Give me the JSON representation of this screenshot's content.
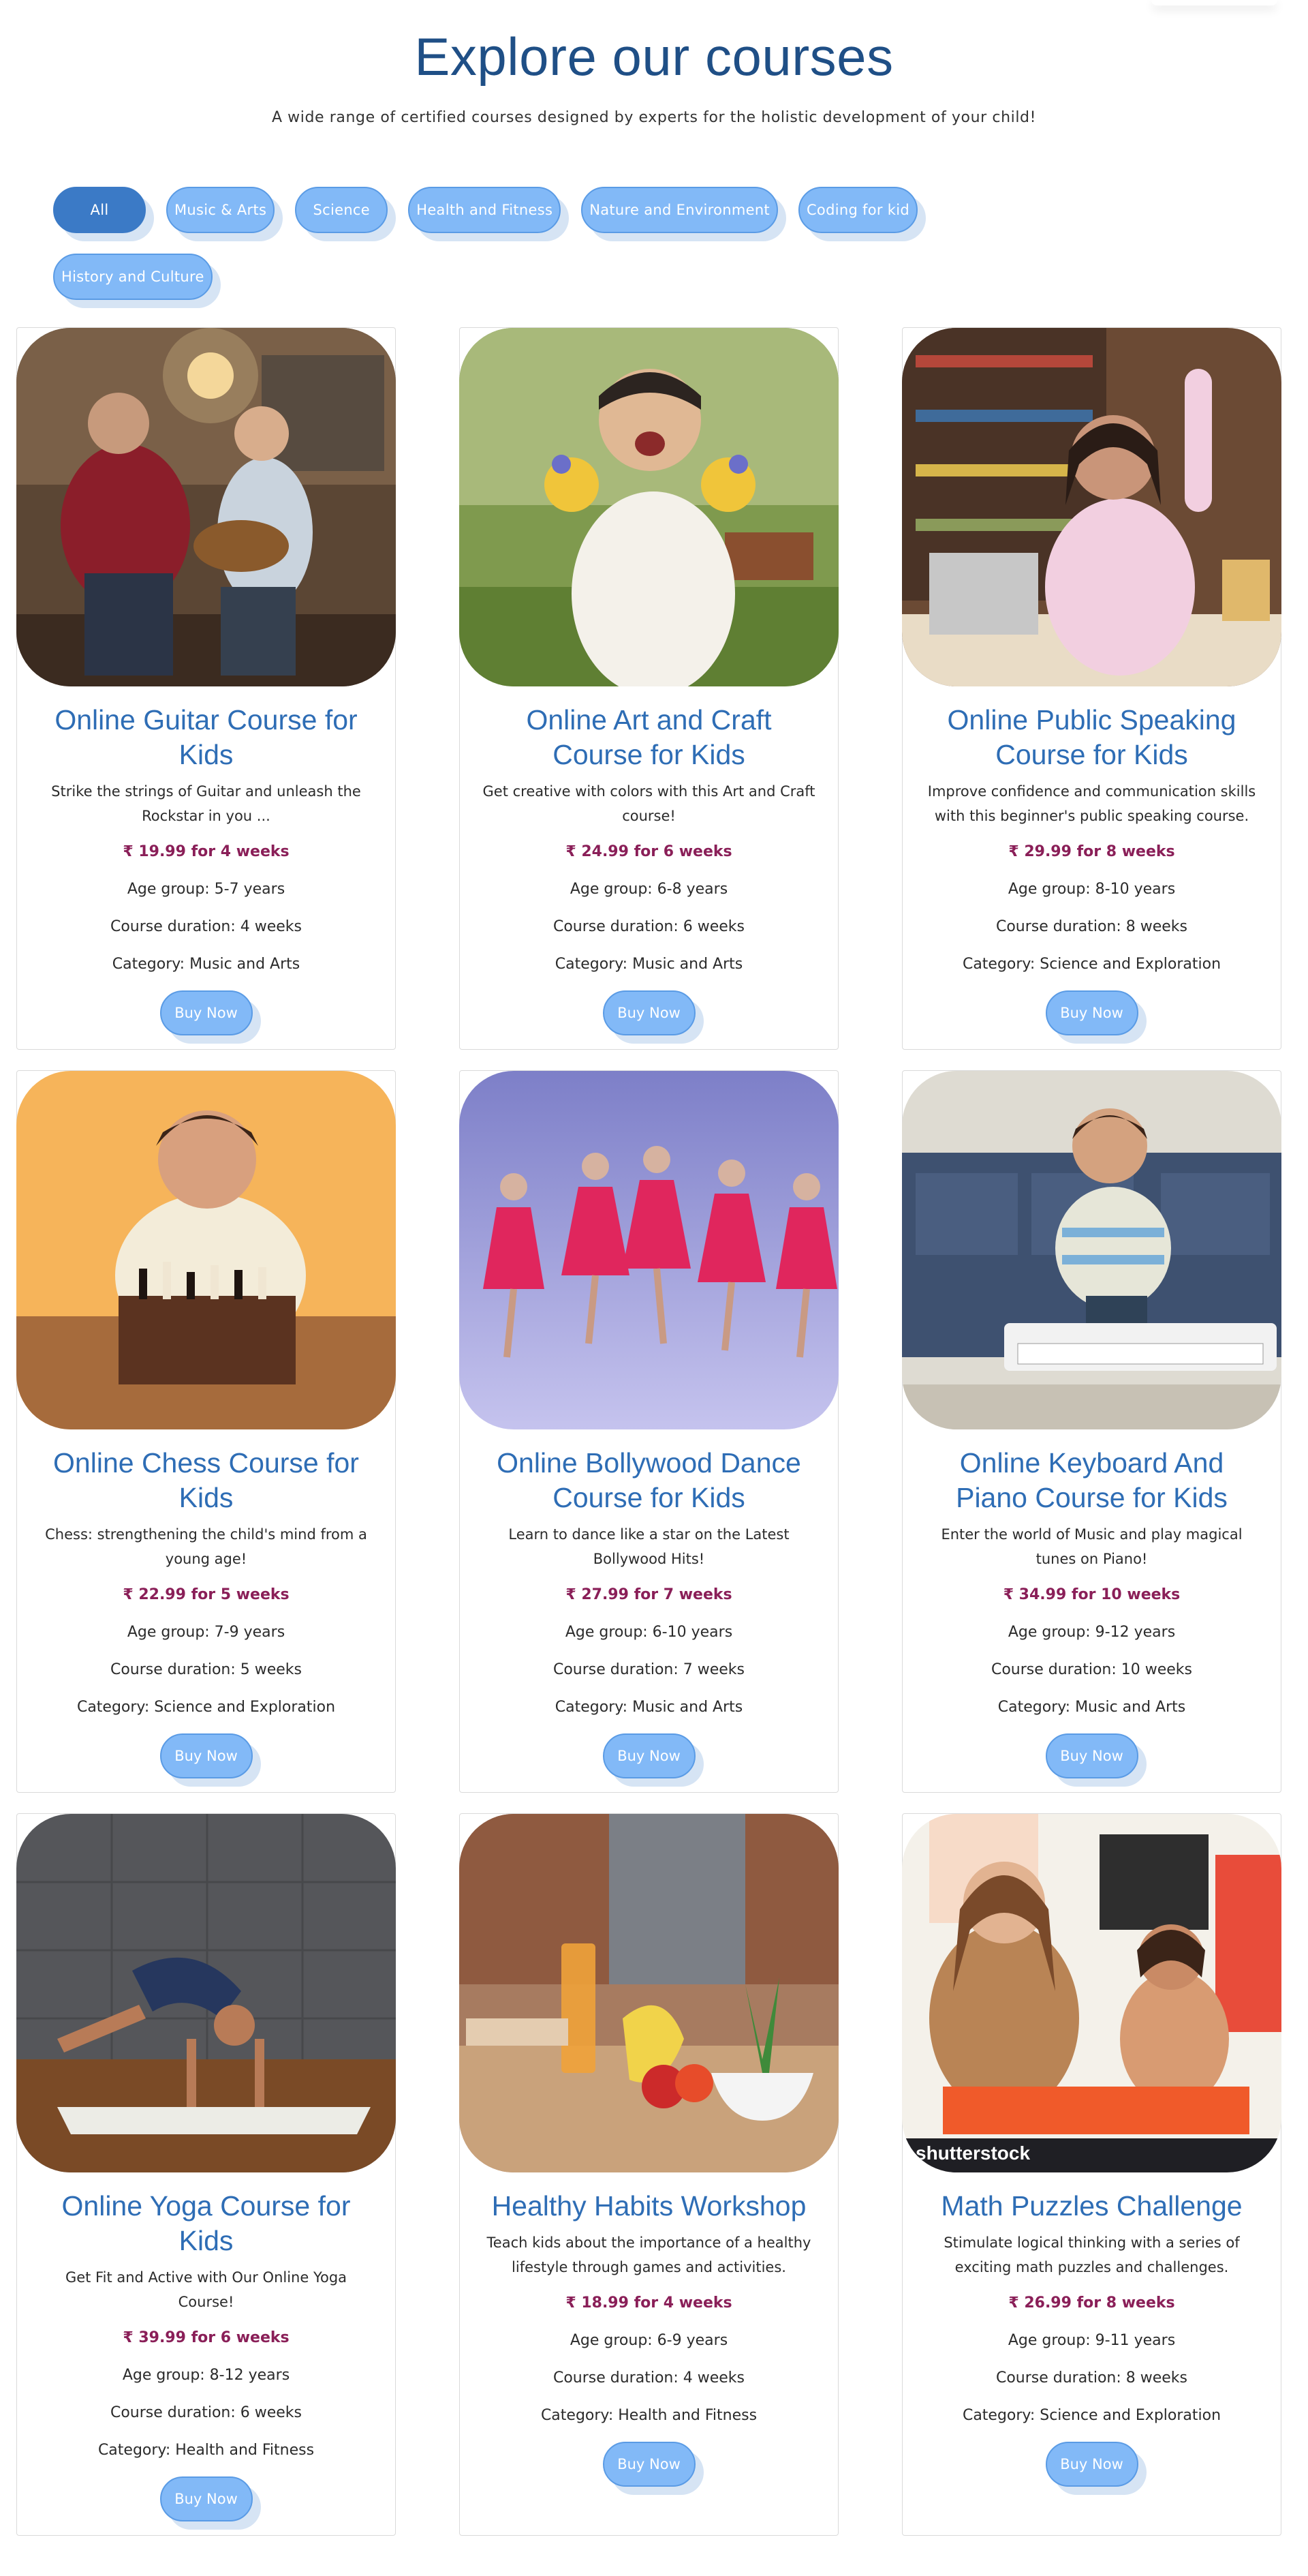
{
  "header": {
    "title": "Explore our courses",
    "subtitle": "A wide range of certified courses designed by experts for the holistic development of your child!"
  },
  "filters": [
    {
      "label": "All",
      "active": true
    },
    {
      "label": "Music & Arts",
      "active": false
    },
    {
      "label": "Science",
      "active": false
    },
    {
      "label": "Health and Fitness",
      "active": false
    },
    {
      "label": "Nature and Environment",
      "active": false
    },
    {
      "label": "Coding for kid",
      "active": false
    },
    {
      "label": "History and Culture",
      "active": false
    }
  ],
  "courses": [
    {
      "title": "Online Guitar Course for Kids",
      "description": "Strike the strings of Guitar and unleash the Rockstar in you ...",
      "price": "₹ 19.99 for 4 weeks",
      "age": "Age group: 5-7 years",
      "duration": "Course duration: 4 weeks",
      "category": "Category: Music and Arts",
      "button": "Buy Now",
      "image": "guitar-lesson-photo"
    },
    {
      "title": "Online Art and Craft Course for Kids",
      "description": "Get creative with colors with this Art and Craft course!",
      "price": "₹ 24.99 for 6 weeks",
      "age": "Age group: 6-8 years",
      "duration": "Course duration: 6 weeks",
      "category": "Category: Music and Arts",
      "button": "Buy Now",
      "image": "painted-hands-child-photo"
    },
    {
      "title": "Online Public Speaking Course for Kids",
      "description": "Improve confidence and communication skills with this beginner's public speaking course.",
      "price": "₹ 29.99 for 8 weeks",
      "age": "Age group: 8-10 years",
      "duration": "Course duration: 8 weeks",
      "category": "Category: Science and Exploration",
      "button": "Buy Now",
      "image": "girl-raising-hand-photo"
    },
    {
      "title": "Online Chess Course for Kids",
      "description": "Chess: strengthening the child's mind from a young age!",
      "price": "₹ 22.99 for 5 weeks",
      "age": "Age group: 7-9 years",
      "duration": "Course duration: 5 weeks",
      "category": "Category: Science and Exploration",
      "button": "Buy Now",
      "image": "boy-with-chess-photo"
    },
    {
      "title": "Online Bollywood Dance Course for Kids",
      "description": "Learn to dance like a star on the Latest Bollywood Hits!",
      "price": "₹ 27.99 for 7 weeks",
      "age": "Age group: 6-10 years",
      "duration": "Course duration: 7 weeks",
      "category": "Category: Music and Arts",
      "button": "Buy Now",
      "image": "dancing-girls-photo"
    },
    {
      "title": "Online Keyboard And Piano Course for Kids",
      "description": "Enter the world of Music and play magical tunes on Piano!",
      "price": "₹ 34.99 for 10 weeks",
      "age": "Age group: 9-12 years",
      "duration": "Course duration: 10 weeks",
      "category": "Category: Music and Arts",
      "button": "Buy Now",
      "image": "boy-keyboard-photo"
    },
    {
      "title": "Online Yoga Course for Kids",
      "description": "Get Fit and Active with Our Online Yoga Course!",
      "price": "₹ 39.99 for 6 weeks",
      "age": "Age group: 8-12 years",
      "duration": "Course duration: 6 weeks",
      "category": "Category: Health and Fitness",
      "button": "Buy Now",
      "image": "yoga-pose-photo"
    },
    {
      "title": "Healthy Habits Workshop",
      "description": "Teach kids about the importance of a healthy lifestyle through games and activities.",
      "price": "₹ 18.99 for 4 weeks",
      "age": "Age group: 6-9 years",
      "duration": "Course duration: 4 weeks",
      "category": "Category: Health and Fitness",
      "button": "Buy Now",
      "image": "fruits-juice-photo"
    },
    {
      "title": "Math Puzzles Challenge",
      "description": "Stimulate logical thinking with a series of exciting math puzzles and challenges.",
      "price": "₹ 26.99 for 8 weeks",
      "age": "Age group: 9-11 years",
      "duration": "Course duration: 8 weeks",
      "category": "Category: Science and Exploration",
      "button": "Buy Now",
      "image": "mother-daughter-puzzle-photo",
      "watermark": "shutterstock"
    }
  ],
  "colors": {
    "title": "#1f4f86",
    "card_title": "#2e6db5",
    "price": "#8a1f58",
    "chip": "#82b9f7",
    "chip_active": "#3b7ac6"
  }
}
